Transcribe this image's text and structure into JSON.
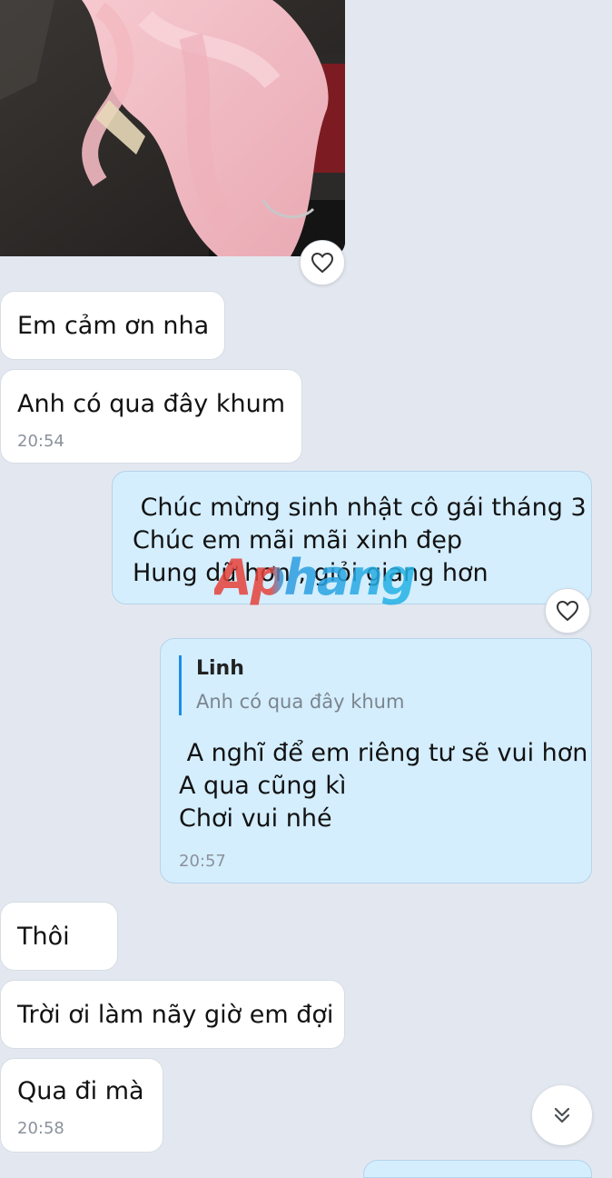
{
  "messages": {
    "m1": {
      "text": "Em cảm ơn nha"
    },
    "m2": {
      "text": "Anh có qua đây khum",
      "time": "20:54"
    },
    "m3": {
      "lines": [
        " Chúc mừng sinh nhật cô gái tháng 3",
        "Chúc em mãi mãi xinh đẹp",
        "Hung dữ hơn , giỏi giang hơn"
      ]
    },
    "m4": {
      "quote_author": "Linh",
      "quote_text": "Anh có qua đây khum",
      "lines": [
        " A nghĩ để em riêng tư sẽ vui hơn",
        "A qua cũng kì",
        "Chơi vui nhé"
      ],
      "time": "20:57"
    },
    "m5": {
      "text": "Thôi"
    },
    "m6": {
      "text": "Trời ơi làm nãy giờ em đợi"
    },
    "m7": {
      "text": "Qua đi mà",
      "time": "20:58"
    }
  },
  "watermark": "Aphang",
  "icons": {
    "react": "heart-icon",
    "scroll": "double-chevron-down-icon"
  },
  "colors": {
    "background": "#e3e8f0",
    "incoming_bubble": "#ffffff",
    "outgoing_bubble": "#d4eefe",
    "quote_bar": "#1a8ee8",
    "timestamp": "#8a929b"
  }
}
